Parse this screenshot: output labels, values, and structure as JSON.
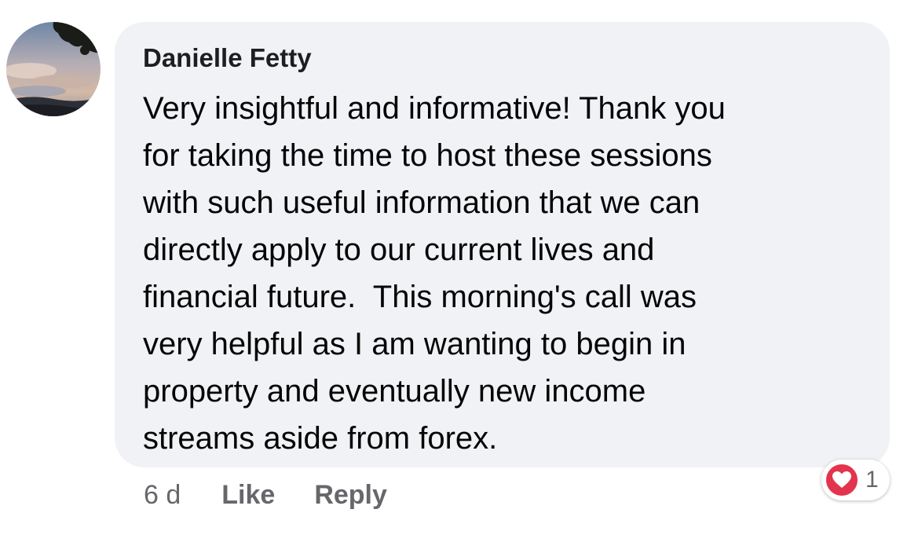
{
  "comment": {
    "author": "Danielle Fetty",
    "text": "Very insightful and informative! Thank you\nfor taking the time to host these sessions\nwith such useful information that we can\ndirectly apply to our current lives and\nfinancial future.  This morning's call was\nvery helpful as I am wanting to begin in\nproperty and eventually new income\nstreams aside from forex.",
    "timestamp": "6 d",
    "like_label": "Like",
    "reply_label": "Reply",
    "reaction": {
      "icon": "heart-icon",
      "count": "1",
      "color": "#e3344d"
    },
    "bubble_color": "#f0f2f5"
  }
}
